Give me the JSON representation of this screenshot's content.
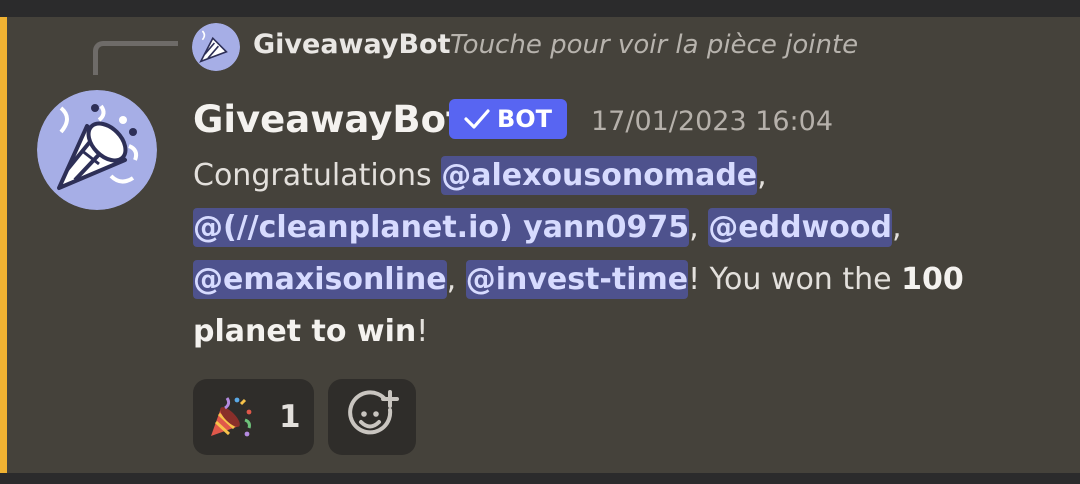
{
  "reply": {
    "author": "GiveawayBot",
    "preview": "Touche pour voir la pièce jointe",
    "avatar_icon": "party-popper-avatar-icon"
  },
  "message": {
    "author": "GiveawayBot",
    "tag_label": "BOT",
    "timestamp": "17/01/2023 16:04",
    "avatar_icon": "party-popper-avatar-icon",
    "text_prefix": "Congratulations ",
    "mentions": [
      "@alexousonomade",
      "@(//cleanplanet.io) yann0975",
      "@eddwood",
      "@emaxisonline",
      "@invest-time"
    ],
    "separators": [
      ",",
      ",",
      ",",
      ","
    ],
    "text_after_mentions": "! You won the ",
    "prize": "100 planet to win",
    "text_end": "!"
  },
  "reactions": [
    {
      "emoji": "party-popper-emoji-icon",
      "count": "1"
    }
  ],
  "add_reaction_icon": "add-reaction-icon",
  "colors": {
    "accent": "#f0b232",
    "bot_tag": "#5865f2",
    "mention_bg": "#5865f2",
    "message_bg": "#45423b"
  }
}
